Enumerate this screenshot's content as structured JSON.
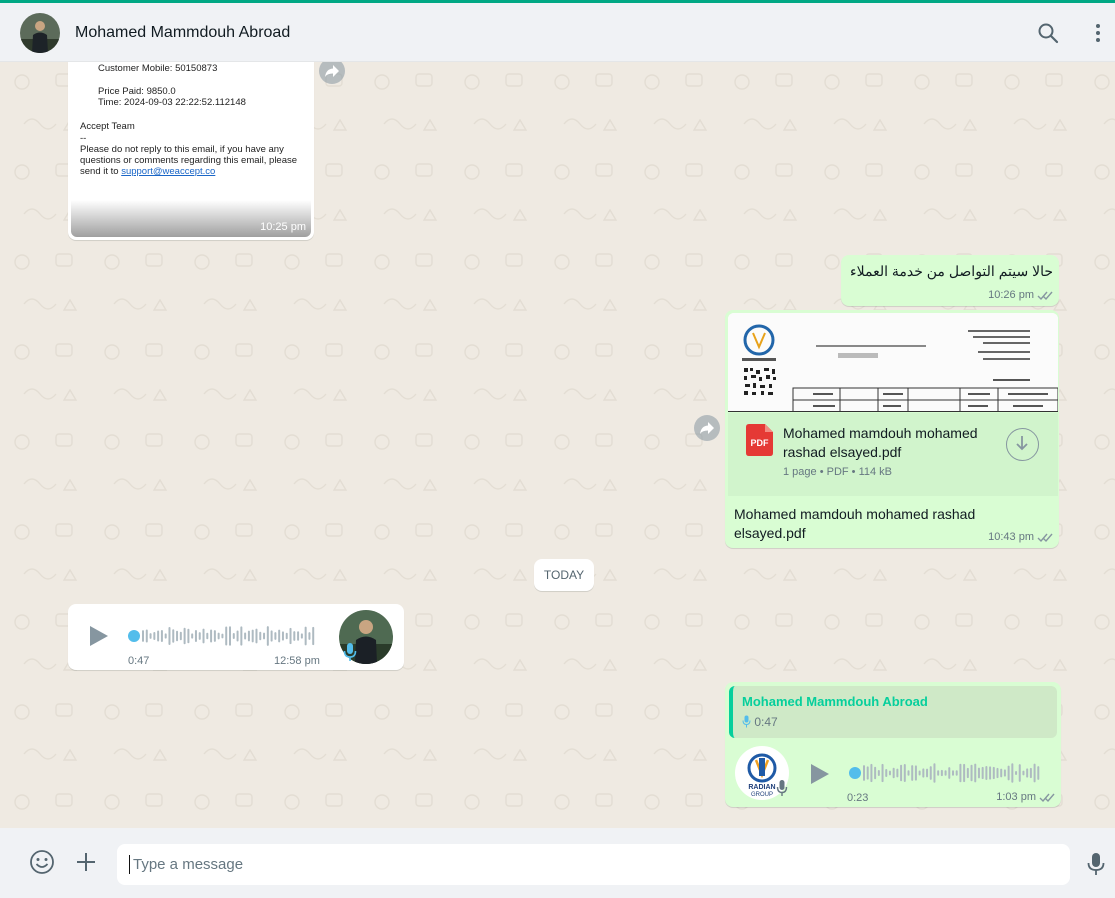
{
  "header": {
    "contact_name": "Mohamed Mammdouh Abroad"
  },
  "email_message": {
    "customer_mobile": "Customer Mobile: 50150873",
    "price_paid": "Price Paid: 9850.0",
    "time": "Time: 2024-09-03 22:22:52.112148",
    "team": "Accept Team",
    "dashes": "--",
    "line1": "Please do not reply to this email, if you have any",
    "line2": "questions or comments regarding this email, please",
    "line3_prefix": "send it to ",
    "support_link": "support@weaccept.co",
    "timestamp": "10:25 pm"
  },
  "arabic_message": {
    "text": "حالا سيتم التواصل من خدمة العملاء",
    "timestamp": "10:26 pm"
  },
  "pdf_message": {
    "file_name_line1": "Mohamed mamdouh mohamed",
    "file_name_line2": "rashad elsayed.pdf",
    "file_info": "1 page • PDF • 114 kB",
    "pdf_badge": "PDF",
    "caption_line1": "Mohamed mamdouh mohamed rashad",
    "caption_line2": "elsayed.pdf",
    "timestamp": "10:43 pm"
  },
  "date_divider": "TODAY",
  "voice_in": {
    "duration": "0:47",
    "timestamp": "12:58 pm"
  },
  "voice_out": {
    "quoted_author": "Mohamed Mammdouh Abroad",
    "quoted_duration": "0:47",
    "duration": "0:23",
    "timestamp": "1:03 pm",
    "logo_text_1": "RADIAN",
    "logo_text_2": "GROUP"
  },
  "composer": {
    "placeholder": "Type a message"
  },
  "colors": {
    "accent": "#00a884",
    "outgoing_bubble": "#d9fdd3",
    "incoming_bubble": "#ffffff",
    "wallpaper": "#efeae2",
    "voice_dot": "#53bdeb"
  }
}
